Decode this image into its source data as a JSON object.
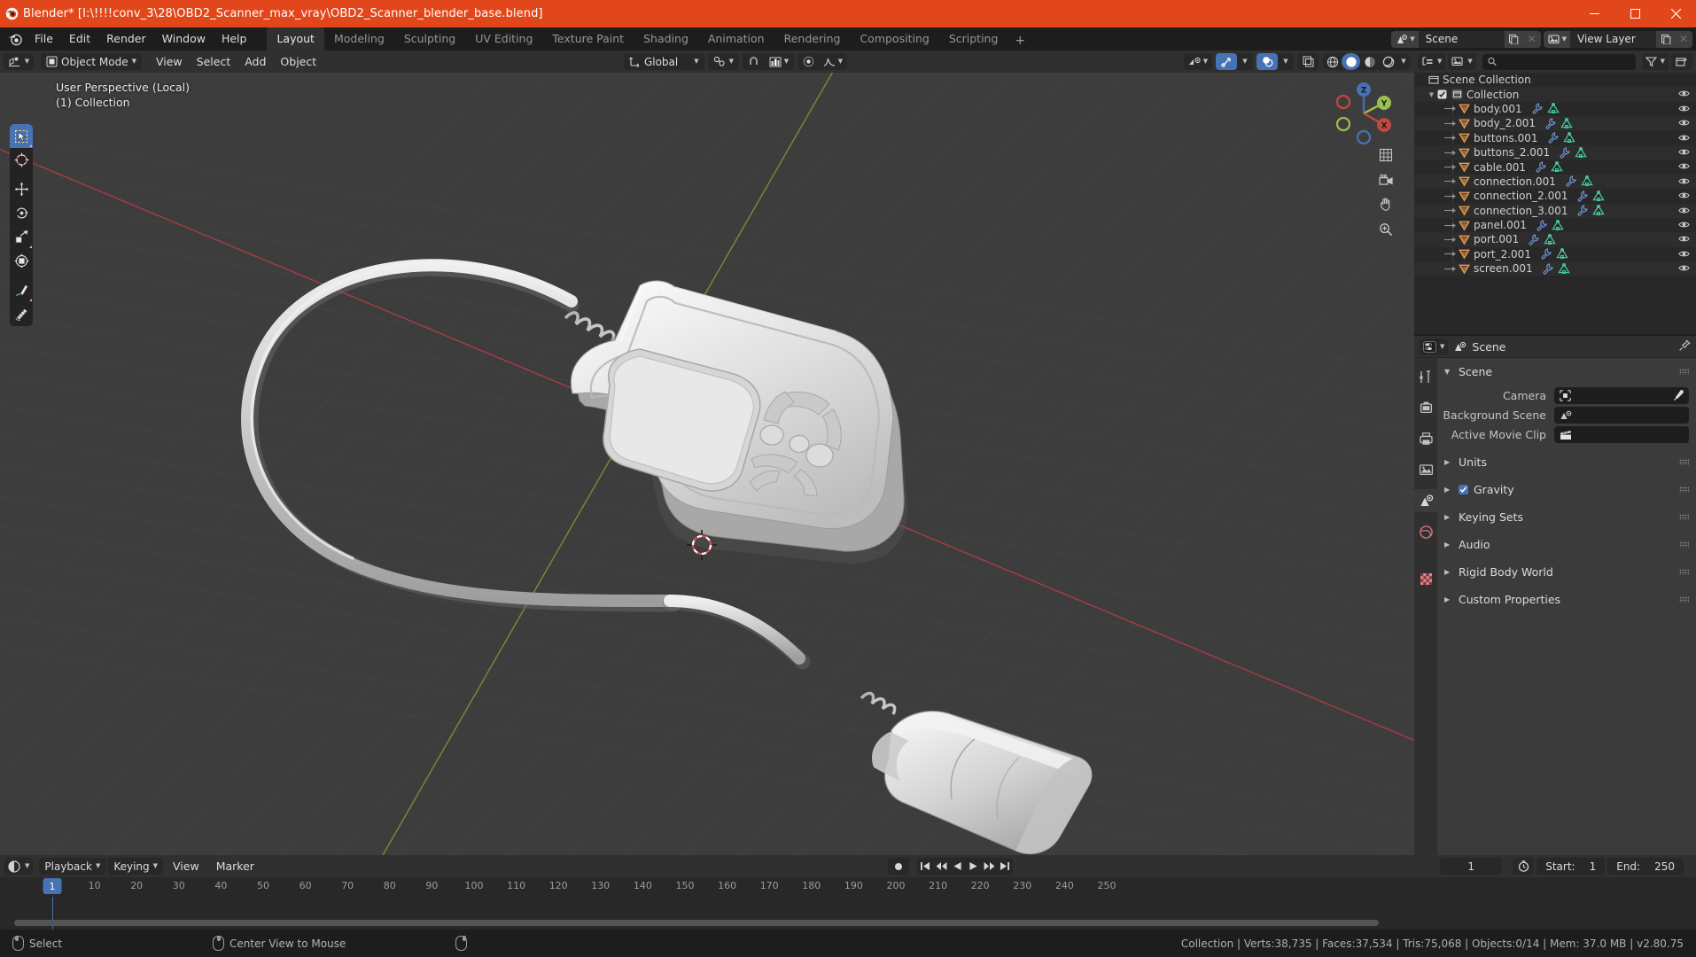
{
  "window": {
    "title": "Blender* [I:\\!!!!conv_3\\28\\OBD2_Scanner_max_vray\\OBD2_Scanner_blender_base.blend]",
    "accent_color": "#e2471c",
    "minimize": "minimize-button",
    "maximize": "maximize-button",
    "close": "close-button"
  },
  "topbar": {
    "menus": [
      "File",
      "Edit",
      "Render",
      "Window",
      "Help"
    ],
    "workspaces": [
      {
        "label": "Layout",
        "active": true
      },
      {
        "label": "Modeling",
        "active": false
      },
      {
        "label": "Sculpting",
        "active": false
      },
      {
        "label": "UV Editing",
        "active": false
      },
      {
        "label": "Texture Paint",
        "active": false
      },
      {
        "label": "Shading",
        "active": false
      },
      {
        "label": "Animation",
        "active": false
      },
      {
        "label": "Rendering",
        "active": false
      },
      {
        "label": "Compositing",
        "active": false
      },
      {
        "label": "Scripting",
        "active": false
      }
    ],
    "add_workspace": "+",
    "scene_name": "Scene",
    "view_layer_name": "View Layer"
  },
  "viewport": {
    "mode": "Object Mode",
    "menus": [
      "View",
      "Select",
      "Add",
      "Object"
    ],
    "transform_orientation": "Global",
    "overlay_line1": "User Perspective (Local)",
    "overlay_line2": "(1) Collection",
    "gizmo_axes": [
      {
        "label": "Z",
        "color": "#4772b3"
      },
      {
        "label": "Y",
        "color": "#8bc34a"
      },
      {
        "label": "X",
        "color": "#e25a5a"
      }
    ],
    "tools": [
      "tweak-select-tool",
      "cursor-tool",
      "move-tool",
      "rotate-tool",
      "scale-tool",
      "transform-tool",
      "annotate-tool",
      "measure-tool"
    ],
    "shading_modes": [
      "wireframe",
      "solid",
      "material-preview",
      "rendered"
    ],
    "active_shading": "solid"
  },
  "outliner": {
    "header": {
      "display_mode": "view-layer",
      "search_placeholder": "",
      "filter": "filter-icon",
      "new_collection": "new-collection-icon"
    },
    "root": "Scene Collection",
    "collection": "Collection",
    "objects": [
      {
        "name": "body.001"
      },
      {
        "name": "body_2.001"
      },
      {
        "name": "buttons.001"
      },
      {
        "name": "buttons_2.001"
      },
      {
        "name": "cable.001"
      },
      {
        "name": "connection.001"
      },
      {
        "name": "connection_2.001"
      },
      {
        "name": "connection_3.001"
      },
      {
        "name": "panel.001"
      },
      {
        "name": "port.001"
      },
      {
        "name": "port_2.001"
      },
      {
        "name": "screen.001"
      }
    ]
  },
  "properties": {
    "breadcrumb": "Scene",
    "tabs": [
      "tool-tab",
      "render-tab",
      "output-tab",
      "view-layer-tab",
      "scene-tab",
      "world-tab",
      "texture-tab"
    ],
    "active_tab": "scene-tab",
    "panels": [
      {
        "label": "Scene",
        "open": true
      },
      {
        "label": "Units",
        "open": false
      },
      {
        "label": "Gravity",
        "open": false,
        "checkbox": true
      },
      {
        "label": "Keying Sets",
        "open": false
      },
      {
        "label": "Audio",
        "open": false
      },
      {
        "label": "Rigid Body World",
        "open": false
      },
      {
        "label": "Custom Properties",
        "open": false
      }
    ],
    "scene_fields": [
      {
        "label": "Camera",
        "value": "",
        "icon": "camera-icon",
        "eyedropper": true
      },
      {
        "label": "Background Scene",
        "value": "",
        "icon": "scene-icon",
        "eyedropper": false
      },
      {
        "label": "Active Movie Clip",
        "value": "",
        "icon": "clip-icon",
        "eyedropper": false
      }
    ]
  },
  "timeline": {
    "menus": [
      "Playback",
      "Keying",
      "View",
      "Marker"
    ],
    "current_frame": "1",
    "start_label": "Start:",
    "start_value": "1",
    "end_label": "End:",
    "end_value": "250",
    "ticks": [
      10,
      20,
      30,
      40,
      50,
      60,
      70,
      80,
      90,
      100,
      110,
      120,
      130,
      140,
      150,
      160,
      170,
      180,
      190,
      200,
      210,
      220,
      230,
      240,
      250
    ],
    "frame_marker": "1"
  },
  "statusbar": {
    "left_items": [
      {
        "icon": "mouse-left-icon",
        "label": "Select"
      },
      {
        "icon": "mouse-middle-icon",
        "label": "Center View to Mouse"
      },
      {
        "icon": "mouse-right-icon",
        "label": ""
      }
    ],
    "stats": "Collection | Verts:38,735 | Faces:37,534 | Tris:75,068 | Objects:0/14 | Mem: 37.0 MB | v2.80.75"
  }
}
